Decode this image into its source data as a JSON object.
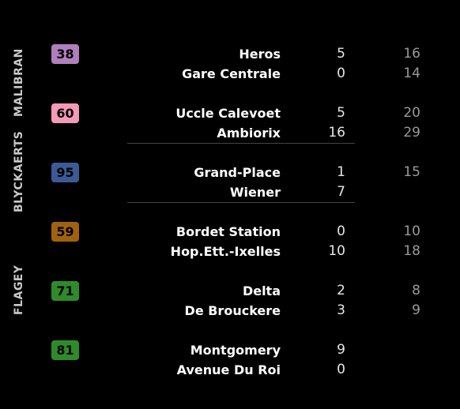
{
  "stops": [
    "MALIBRAN",
    "BLYCKAERTS",
    "FLAGEY"
  ],
  "lines": [
    {
      "number": "38",
      "color": "#b07fbd",
      "departures": [
        {
          "dest": "Heros",
          "m1": "5",
          "m2": "16"
        },
        {
          "dest": "Gare Centrale",
          "m1": "0",
          "m2": "14"
        }
      ]
    },
    {
      "number": "60",
      "color": "#f39ab6",
      "departures": [
        {
          "dest": "Uccle Calevoet",
          "m1": "5",
          "m2": "20"
        },
        {
          "dest": "Ambiorix",
          "m1": "16",
          "m2": "29"
        }
      ]
    },
    {
      "number": "95",
      "color": "#3c5a96",
      "departures": [
        {
          "dest": "Grand-Place",
          "m1": "1",
          "m2": "15"
        },
        {
          "dest": "Wiener",
          "m1": "7",
          "m2": ""
        }
      ]
    },
    {
      "number": "59",
      "color": "#a0620f",
      "departures": [
        {
          "dest": "Bordet Station",
          "m1": "0",
          "m2": "10"
        },
        {
          "dest": "Hop.Ett.-Ixelles",
          "m1": "10",
          "m2": "18"
        }
      ]
    },
    {
      "number": "71",
      "color": "#2e8b2a",
      "departures": [
        {
          "dest": "Delta",
          "m1": "2",
          "m2": "8"
        },
        {
          "dest": "De Brouckere",
          "m1": "3",
          "m2": "9"
        }
      ]
    },
    {
      "number": "81",
      "color": "#2e8b2a",
      "departures": [
        {
          "dest": "Montgomery",
          "m1": "9",
          "m2": ""
        },
        {
          "dest": "Avenue Du Roi",
          "m1": "0",
          "m2": ""
        }
      ]
    }
  ]
}
